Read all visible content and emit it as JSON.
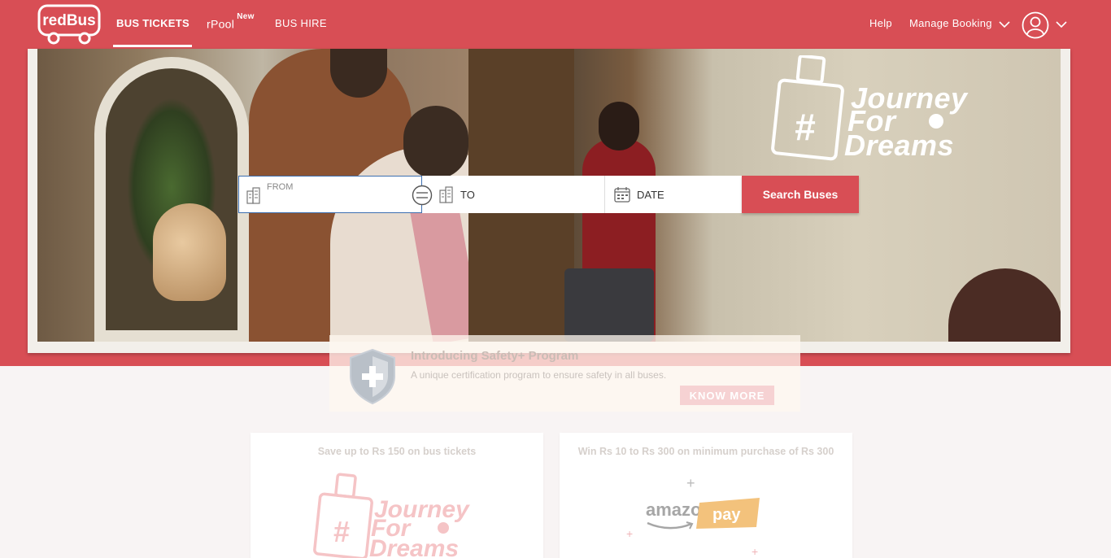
{
  "header": {
    "logo_text": "redBus",
    "nav": {
      "bus_tickets": "BUS TICKETS",
      "rpool": "rPool",
      "rpool_badge": "New",
      "bus_hire": "BUS HIRE",
      "help": "Help",
      "manage_booking": "Manage Booking"
    }
  },
  "hero": {
    "brand_lines": [
      "Journey",
      "For",
      "Dreams"
    ],
    "brand_hash": "#"
  },
  "search": {
    "from_label": "FROM",
    "to_label": "TO",
    "date_label": "DATE",
    "button_label": "Search Buses"
  },
  "safety": {
    "title": "Introducing Safety+ Program",
    "description": "A unique certification program to ensure safety in all buses.",
    "button_label": "KNOW MORE"
  },
  "offers": [
    {
      "title": "Save up to Rs 150 on bus tickets",
      "brand_lines": [
        "Journey",
        "For",
        "Dreams"
      ]
    },
    {
      "title": "Win Rs 10 to Rs 300 on minimum purchase of Rs 300",
      "amazon": "amazon",
      "pay": "pay"
    }
  ],
  "colors": {
    "brand_red": "#d84e55",
    "white": "#ffffff",
    "focus_blue": "#3d6fb0"
  }
}
